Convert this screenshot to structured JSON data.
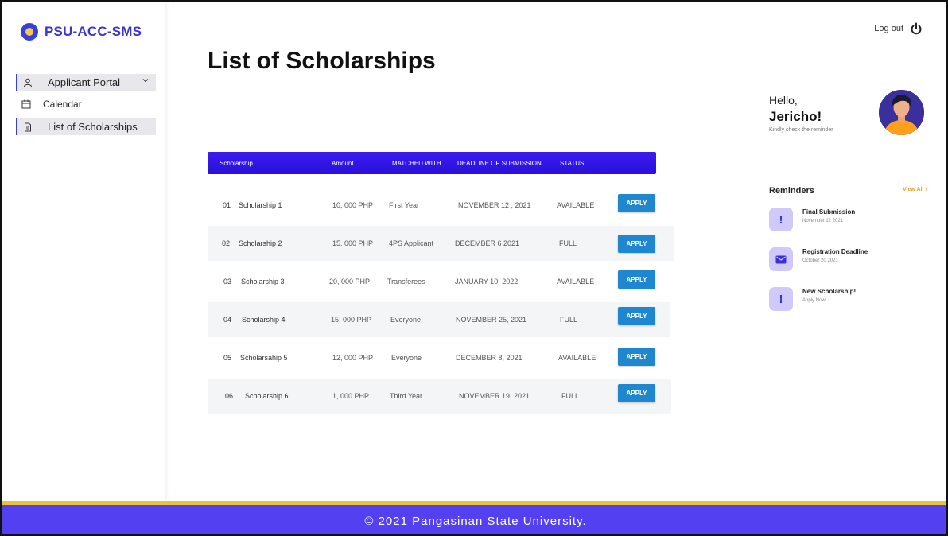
{
  "brand": {
    "name": "PSU-ACC-SMS",
    "logo_icon": "university-seal-icon"
  },
  "sidebar": {
    "items": [
      {
        "label": "Applicant Portal",
        "icon": "user-icon",
        "has_chevron": true
      },
      {
        "label": "Calendar",
        "icon": "calendar-icon"
      },
      {
        "label": "List of Scholarships",
        "icon": "document-icon",
        "active": true
      }
    ]
  },
  "header": {
    "logout_label": "Log out",
    "logout_icon": "power-icon"
  },
  "page": {
    "title": "List of Scholarships"
  },
  "table": {
    "headers": {
      "scholarship": "Scholarship",
      "amount": "Amount",
      "matched": "MATCHED WITH",
      "deadline": "DEADLINE OF SUBMISSION",
      "status": "STATUS"
    },
    "rows": [
      {
        "num": "01",
        "name": "Scholarship 1",
        "amount": "10, 000 PHP",
        "matched": "First Year",
        "deadline": "NOVEMBER 12 , 2021",
        "status": "AVAILABLE",
        "action": "APPLY"
      },
      {
        "num": "02",
        "name": "Scholarship 2",
        "amount": "15. 000 PHP",
        "matched": "4PS Applicant",
        "deadline": "DECEMBER 6 2021",
        "status": "FULL",
        "action": "APPLY"
      },
      {
        "num": "03",
        "name": "Scholarship 3",
        "amount": "20, 000 PHP",
        "matched": "Transferees",
        "deadline": "JANUARY 10, 2022",
        "status": "AVAILABLE",
        "action": "APPLY"
      },
      {
        "num": "04",
        "name": "Scholarship 4",
        "amount": "15, 000 PHP",
        "matched": "Everyone",
        "deadline": "NOVEMBER 25, 2021",
        "status": "FULL",
        "action": "APPLY"
      },
      {
        "num": "05",
        "name": "Scholarsahip 5",
        "amount": "12, 000 PHP",
        "matched": "Everyone",
        "deadline": "DECEMBER 8,  2021",
        "status": "AVAILABLE",
        "action": "APPLY"
      },
      {
        "num": "06",
        "name": "Scholarship 6",
        "amount": "1, 000 PHP",
        "matched": "Third Year",
        "deadline": "NOVEMBER 19, 2021",
        "status": "FULL",
        "action": "APPLY"
      }
    ]
  },
  "profile": {
    "greeting": "Hello,",
    "name": "Jericho!",
    "subtitle": "Kindly check the reminder"
  },
  "reminders": {
    "title": "Reminders",
    "view_all": "View All",
    "items": [
      {
        "title": "Final Submission",
        "subtitle": "November 12 2021",
        "icon": "exclamation-icon"
      },
      {
        "title": "Registration Deadline",
        "subtitle": "October 20 2021",
        "icon": "mail-icon"
      },
      {
        "title": "New Scholarship!",
        "subtitle": "Apply Now!",
        "icon": "exclamation-icon"
      }
    ]
  },
  "footer": {
    "text": "© 2021 Pangasinan State University."
  },
  "colors": {
    "brand": "#3a33d6",
    "table_header": "#2a10d8",
    "apply_button": "#1f86d0",
    "footer": "#5340f0",
    "footer_stripe": "#e8c43a",
    "view_all": "#f39c12"
  }
}
